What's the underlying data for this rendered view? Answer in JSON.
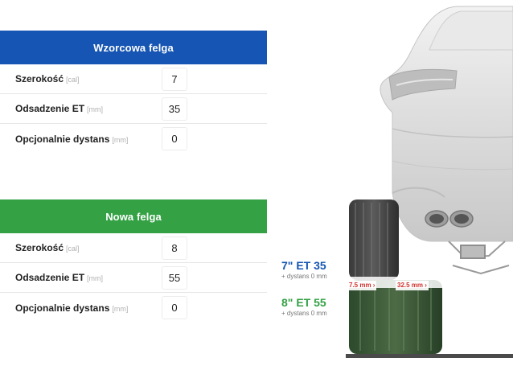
{
  "reference_rim": {
    "title": "Wzorcowa felga",
    "rows": [
      {
        "label": "Szerokość",
        "unit": "[cal]",
        "value": "7"
      },
      {
        "label": "Odsadzenie ET",
        "unit": "[mm]",
        "value": "35"
      },
      {
        "label": "Opcjonalnie dystans",
        "unit": "[mm]",
        "value": "0"
      }
    ]
  },
  "new_rim": {
    "title": "Nowa felga",
    "rows": [
      {
        "label": "Szerokość",
        "unit": "[cal]",
        "value": "8"
      },
      {
        "label": "Odsadzenie ET",
        "unit": "[mm]",
        "value": "55"
      },
      {
        "label": "Opcjonalnie dystans",
        "unit": "[mm]",
        "value": "0"
      }
    ]
  },
  "comparison": {
    "reference_spec": "7\" ET 35",
    "reference_spacer": "+ dystans 0 mm",
    "new_spec": "8\" ET 55",
    "new_spacer": "+ dystans 0 mm",
    "inner_difference": "7.5 mm ›",
    "outer_difference": "32.5 mm ›"
  },
  "colors": {
    "reference_accent": "#1655b3",
    "new_accent": "#33a144",
    "difference": "#d0312d"
  }
}
